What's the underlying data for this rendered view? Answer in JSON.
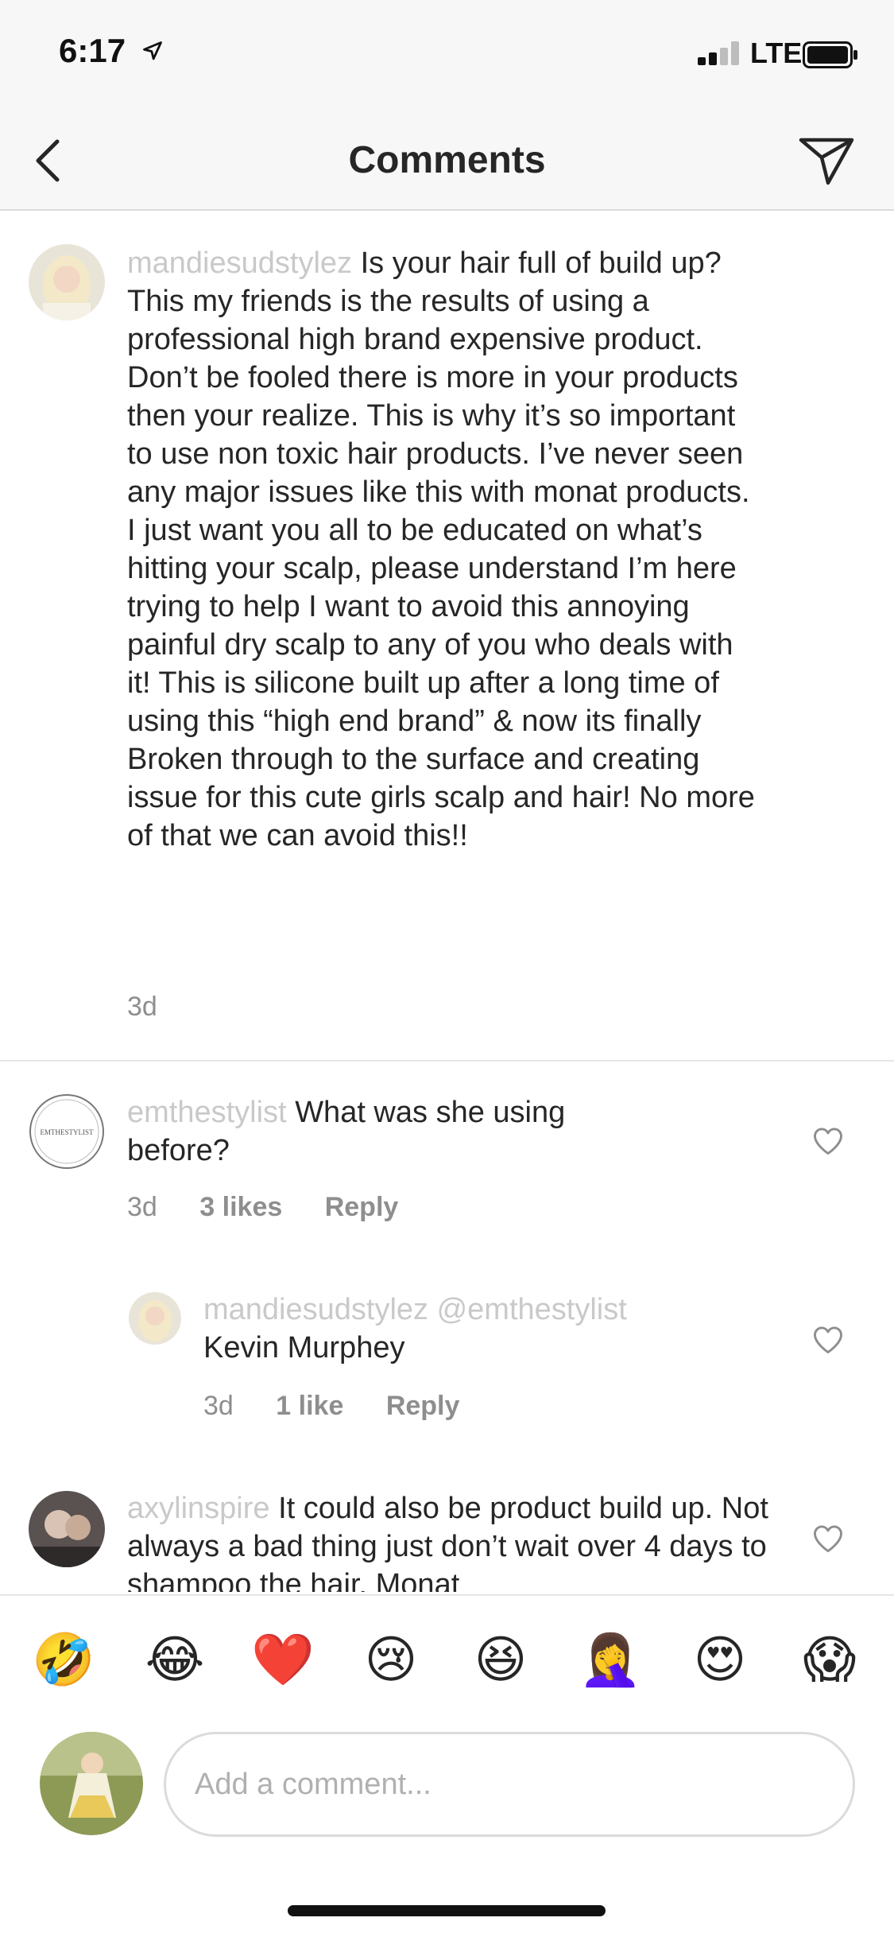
{
  "status_bar": {
    "time": "6:17",
    "network": "LTE",
    "location_icon": "location-arrow-icon",
    "signal_icon": "signal-bars-icon",
    "battery_icon": "battery-icon"
  },
  "nav": {
    "title": "Comments",
    "back_icon": "chevron-left-icon",
    "share_icon": "send-icon"
  },
  "comments": [
    {
      "username": "mandiesudstylez",
      "text": "Is your hair full of build up? This my friends is the results of using a professional high brand expensive  product. Don’t be fooled there is more in your products then your realize. This is why it’s so important to use non toxic hair products. I’ve never seen any major issues like this with monat products. I just want you all to be educated on what’s hitting your scalp, please understand I’m here trying to help I want to avoid this annoying painful dry scalp to any of you who deals with it! This is silicone built up after a long time of using this “high end brand” & now its finally Broken through to the surface and creating issue for this cute girls scalp and hair! No more of that we can avoid this!!",
      "time": "3d"
    },
    {
      "username": "emthestylist",
      "text": "What was she using before?",
      "time": "3d",
      "likes": "3 likes",
      "reply": "Reply",
      "avatar_text": "EMTHESTYLIST"
    },
    {
      "username": "mandiesudstylez @emthestylist",
      "text": "Kevin Murphey",
      "time": "3d",
      "likes": "1 like",
      "reply": "Reply"
    },
    {
      "username": "axylinspire",
      "text": "It could also be product build up. Not always a bad thing just don’t wait over 4 days to shampoo the hair. Monat"
    }
  ],
  "emojis": [
    "🤣",
    "😂",
    "❤️",
    "😢",
    "😆",
    "🤦‍♀️",
    "😍",
    "😱"
  ],
  "composer": {
    "placeholder": "Add a comment..."
  },
  "colors": {
    "text": "#262626",
    "muted": "#8e8e8e",
    "faded_username": "#c9c9c9",
    "bar_background": "#f7f7f7",
    "heart_red": "#e0141e"
  }
}
